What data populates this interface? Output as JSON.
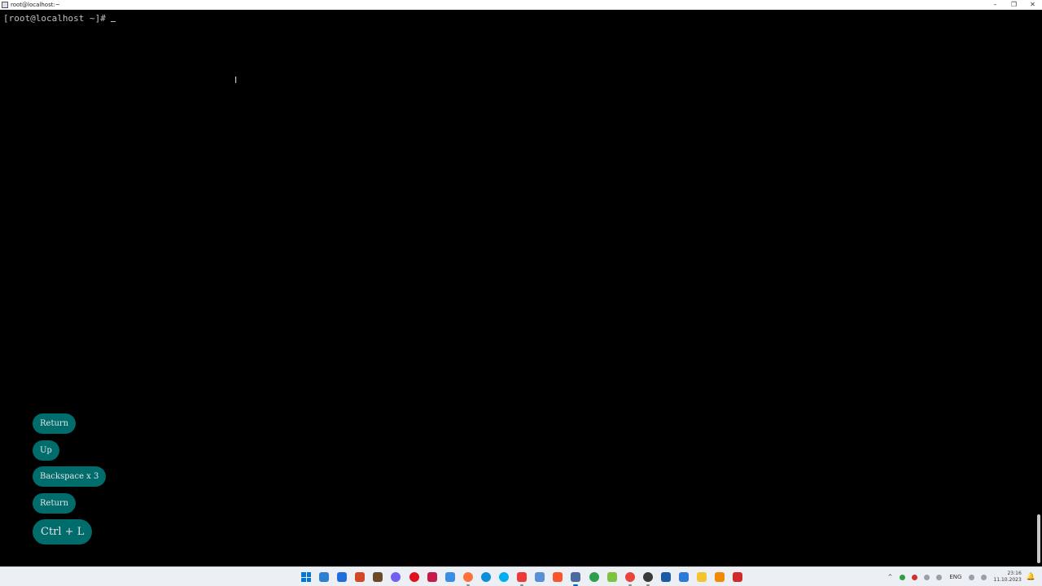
{
  "window": {
    "title": "root@localhost:~",
    "minimize_glyph": "–",
    "maximize_glyph": "❐",
    "close_glyph": "✕"
  },
  "terminal": {
    "prompt": "[root@localhost ~]# "
  },
  "keystrokes": {
    "items": [
      "Return",
      "Up",
      "Backspace x 3",
      "Return"
    ],
    "latest": "Ctrl + L"
  },
  "taskbar": {
    "icons": [
      {
        "name": "start-icon",
        "color": "#0078d4"
      },
      {
        "name": "widgets-icon",
        "color": "#2f7fd1"
      },
      {
        "name": "remote-desktop-icon",
        "color": "#1e6fd9"
      },
      {
        "name": "powerpoint-icon",
        "color": "#d24726"
      },
      {
        "name": "archive-icon",
        "color": "#6b4a2a"
      },
      {
        "name": "viber-icon",
        "color": "#7360f2"
      },
      {
        "name": "opera-icon",
        "color": "#e0101d"
      },
      {
        "name": "raspberry-pi-icon",
        "color": "#c51a4a"
      },
      {
        "name": "feather-icon",
        "color": "#3a8ee6"
      },
      {
        "name": "firefox-icon",
        "color": "#ff7139"
      },
      {
        "name": "edge-icon",
        "color": "#0c8fd8"
      },
      {
        "name": "skype-icon",
        "color": "#00aff0"
      },
      {
        "name": "vivaldi-icon",
        "color": "#ef3939"
      },
      {
        "name": "snipping-tool-icon",
        "color": "#5a8fd6"
      },
      {
        "name": "brave-icon",
        "color": "#fb542b"
      },
      {
        "name": "putty-icon",
        "color": "#4a6aa0"
      },
      {
        "name": "greenshot-icon",
        "color": "#2e9e4a"
      },
      {
        "name": "notepad-plus-icon",
        "color": "#7fc241"
      },
      {
        "name": "chrome-icon",
        "color": "#e8453c"
      },
      {
        "name": "obs-icon",
        "color": "#3a3a3a"
      },
      {
        "name": "virtualbox-icon",
        "color": "#1c5aa6"
      },
      {
        "name": "remote-viewer-icon",
        "color": "#2b7bd6"
      },
      {
        "name": "file-explorer-icon",
        "color": "#f4c430"
      },
      {
        "name": "vlc-icon",
        "color": "#f08a00"
      },
      {
        "name": "screen-recorder-icon",
        "color": "#d22a2a"
      }
    ],
    "tray": {
      "language": "ENG",
      "time": "23:16",
      "date": "11.10.2023",
      "chevron_glyph": "^",
      "bell_glyph": "🔔"
    }
  }
}
